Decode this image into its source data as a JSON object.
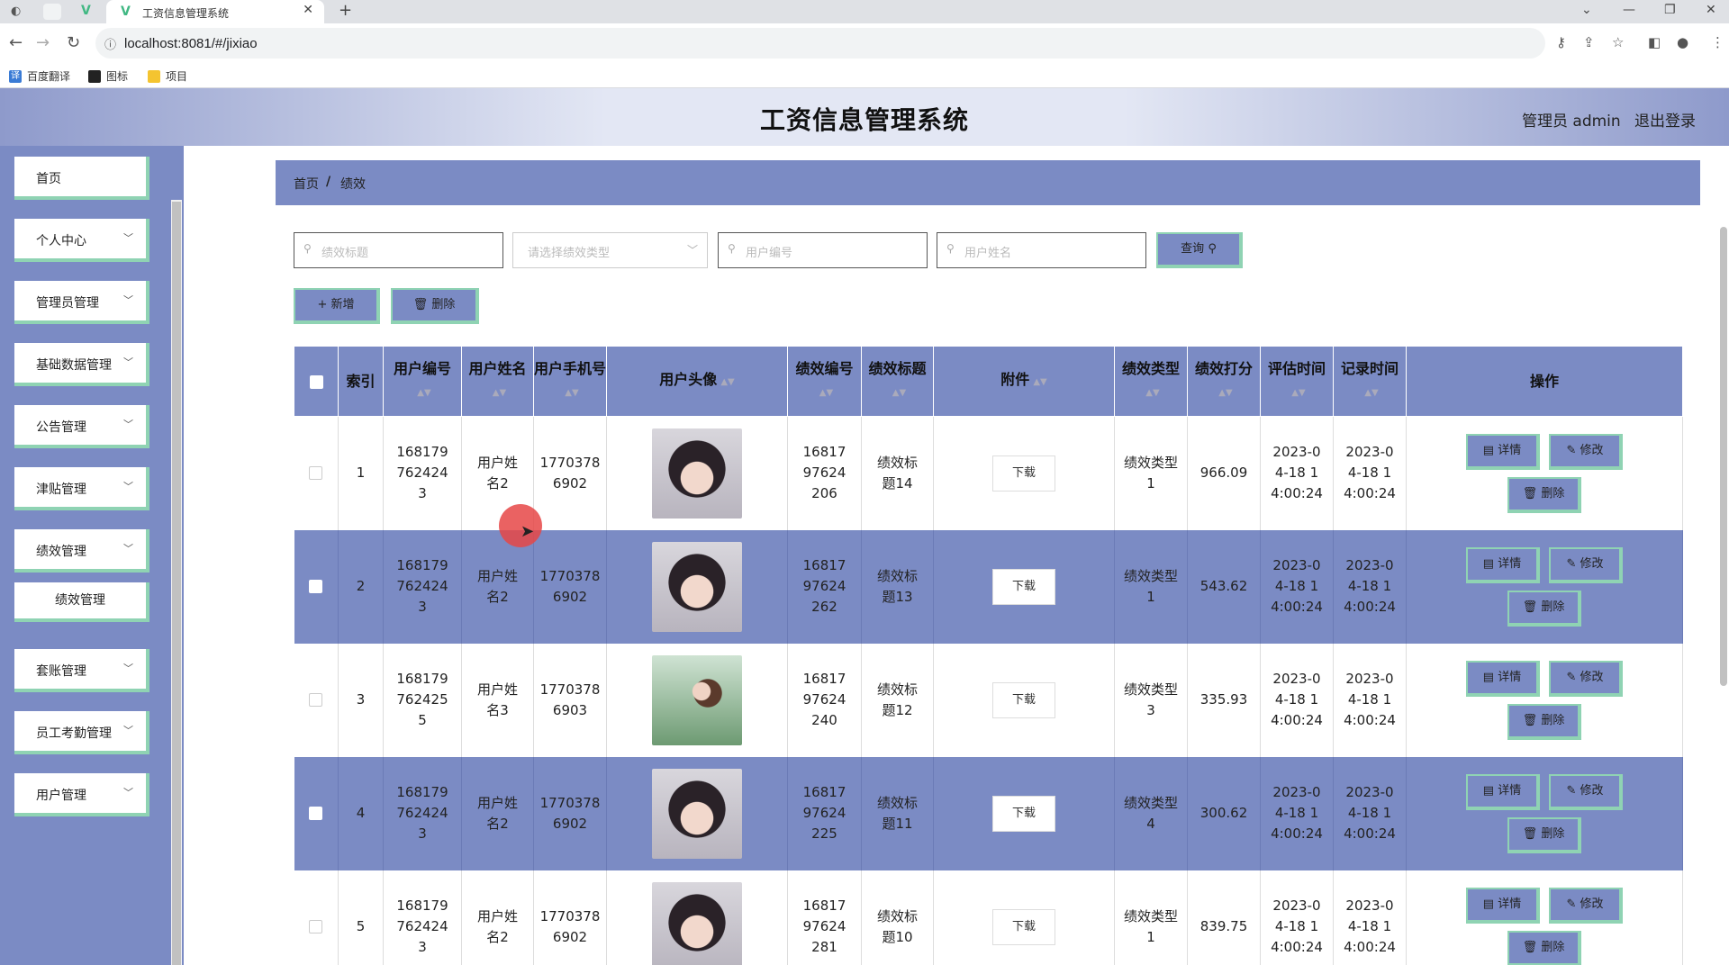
{
  "browser": {
    "tab_title": "工资信息管理系统",
    "url": "localhost:8081/#/jixiao",
    "bookmarks": [
      "百度翻译",
      "图标",
      "项目"
    ]
  },
  "header": {
    "title": "工资信息管理系统",
    "user_label": "管理员 admin",
    "logout_label": "退出登录"
  },
  "sidebar": {
    "items": [
      {
        "label": "首页"
      },
      {
        "label": "个人中心"
      },
      {
        "label": "管理员管理"
      },
      {
        "label": "基础数据管理"
      },
      {
        "label": "公告管理"
      },
      {
        "label": "津贴管理"
      },
      {
        "label": "绩效管理"
      },
      {
        "label": "绩效管理"
      },
      {
        "label": "套账管理"
      },
      {
        "label": "员工考勤管理"
      },
      {
        "label": "用户管理"
      }
    ]
  },
  "breadcrumb": {
    "home": "首页",
    "sep": "/",
    "current": "绩效"
  },
  "search": {
    "title_placeholder": "绩效标题",
    "type_placeholder": "请选择绩效类型",
    "user_no_placeholder": "用户编号",
    "user_name_placeholder": "用户姓名",
    "query_label": "查询"
  },
  "actions": {
    "add_label": "+ 新增",
    "delete_label": "删除"
  },
  "table": {
    "headers": [
      "索引",
      "用户编号",
      "用户姓名",
      "用户手机号",
      "用户头像",
      "绩效编号",
      "绩效标题",
      "附件",
      "绩效类型",
      "绩效打分",
      "评估时间",
      "记录时间",
      "操作"
    ],
    "download_label": "下载",
    "detail_label": "详情",
    "edit_label": "修改",
    "delete_label": "删除",
    "rows": [
      {
        "index": "1",
        "user_no": "1681797624243",
        "user_name": "用户姓名2",
        "phone": "17703786902",
        "perf_no": "1681797624206",
        "perf_title": "绩效标题14",
        "perf_type": "绩效类型1",
        "score": "966.09",
        "eval_time": "2023-04-18 14:00:24",
        "record_time": "2023-04-18 14:00:24"
      },
      {
        "index": "2",
        "user_no": "1681797624243",
        "user_name": "用户姓名2",
        "phone": "17703786902",
        "perf_no": "1681797624262",
        "perf_title": "绩效标题13",
        "perf_type": "绩效类型1",
        "score": "543.62",
        "eval_time": "2023-04-18 14:00:24",
        "record_time": "2023-04-18 14:00:24"
      },
      {
        "index": "3",
        "user_no": "1681797624255",
        "user_name": "用户姓名3",
        "phone": "17703786903",
        "perf_no": "1681797624240",
        "perf_title": "绩效标题12",
        "perf_type": "绩效类型3",
        "score": "335.93",
        "eval_time": "2023-04-18 14:00:24",
        "record_time": "2023-04-18 14:00:24"
      },
      {
        "index": "4",
        "user_no": "1681797624243",
        "user_name": "用户姓名2",
        "phone": "17703786902",
        "perf_no": "1681797624225",
        "perf_title": "绩效标题11",
        "perf_type": "绩效类型4",
        "score": "300.62",
        "eval_time": "2023-04-18 14:00:24",
        "record_time": "2023-04-18 14:00:24"
      },
      {
        "index": "5",
        "user_no": "1681797624243",
        "user_name": "用户姓名2",
        "phone": "17703786902",
        "perf_no": "1681797624281",
        "perf_title": "绩效标题10",
        "perf_type": "绩效类型1",
        "score": "839.75",
        "eval_time": "2023-04-18 14:00:24",
        "record_time": "2023-04-18 14:00:24"
      }
    ]
  }
}
